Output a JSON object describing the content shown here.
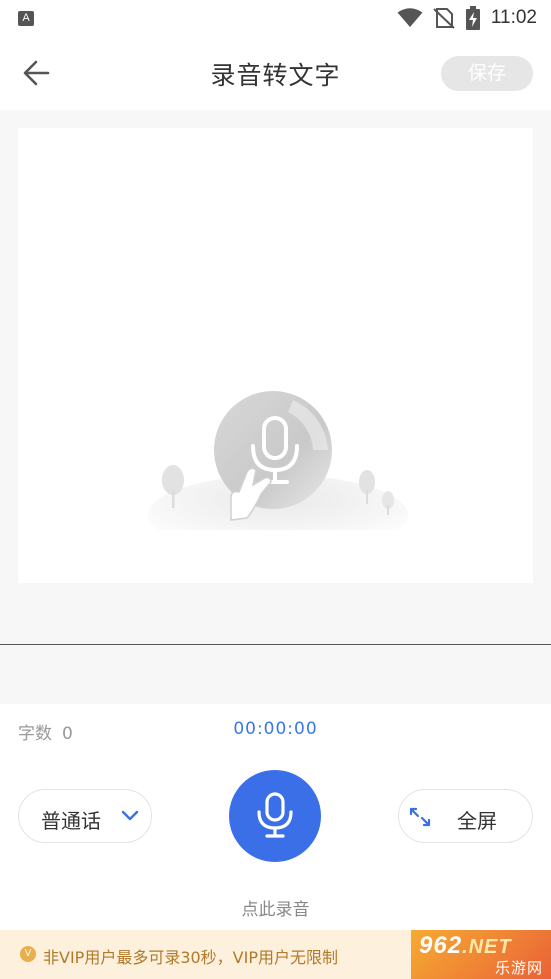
{
  "status_bar": {
    "left_icon": "A",
    "icons": [
      "wifi-icon",
      "no-sim-icon",
      "battery-charging-icon"
    ],
    "time": "11:02"
  },
  "app_bar": {
    "title": "录音转文字",
    "save_label": "保存",
    "back_icon": "arrow-left-icon"
  },
  "content": {
    "illustration": "microphone-tap-illustration"
  },
  "info_row": {
    "word_count_label": "字数",
    "word_count_value": "0",
    "timer": "00:00:00"
  },
  "controls": {
    "language_label": "普通话",
    "language_icon": "chevron-down-icon",
    "record_icon": "microphone-icon",
    "fullscreen_label": "全屏",
    "fullscreen_icon": "expand-icon",
    "hint": "点此录音"
  },
  "vip_banner": {
    "icon_text": "V",
    "text": "非VIP用户最多可录30秒，VIP用户无限制"
  },
  "watermark": {
    "main": "962",
    "suffix": ".NET",
    "sub": "乐游网"
  },
  "colors": {
    "accent": "#3b6fe8",
    "timer": "#3b78e7",
    "banner_bg": "#fdf0dc",
    "banner_text": "#b07a2a",
    "save_disabled": "#e6e6e6"
  }
}
